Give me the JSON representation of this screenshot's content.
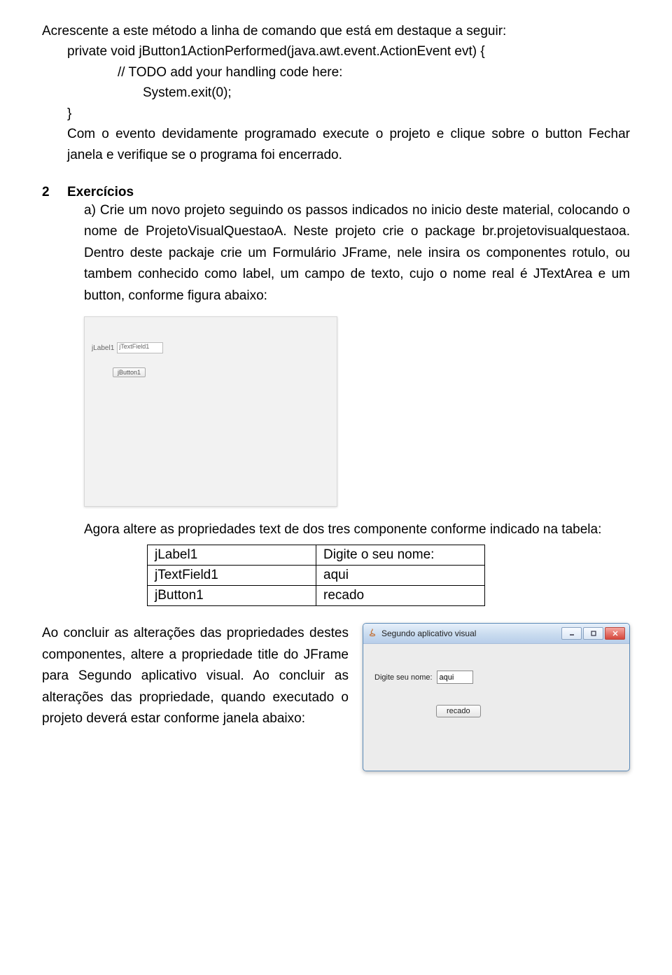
{
  "intro": {
    "line": "Acrescente a este método a linha de comando que está em destaque a seguir:"
  },
  "code": {
    "l1": "private void jButton1ActionPerformed(java.awt.event.ActionEvent evt) {",
    "l2": "// TODO add your handling code here:",
    "l3": "System.exit(0);",
    "l4": "}",
    "after": "Com o evento devidamente programado execute o projeto e clique sobre o button Fechar janela e verifique se o programa foi encerrado."
  },
  "section": {
    "num": "2",
    "title": "Exercícios"
  },
  "exercise": {
    "a": "a) Crie um novo projeto seguindo os passos indicados no inicio deste material, colocando o nome de ProjetoVisualQuestaoA. Neste projeto crie o package br.projetovisualquestaoa. Dentro deste packaje crie um Formulário JFrame, nele insira os componentes rotulo, ou tambem conhecido como label, um campo de texto, cujo o nome real é JTextArea e um button, conforme figura abaixo:"
  },
  "mock1": {
    "label": "jLabel1",
    "textfield": "jTextField1",
    "button": "jButton1"
  },
  "between": "Agora altere as propriedades text de dos tres componente conforme indicado na tabela:",
  "table": {
    "r1c1": "jLabel1",
    "r1c2": "Digite o seu nome:",
    "r2c1": "jTextField1",
    "r2c2": "aqui",
    "r3c1": "jButton1",
    "r3c2": "recado"
  },
  "final_para": "Ao concluir as alterações das propriedades destes componentes, altere a propriedade title do JFrame para Segundo aplicativo visual. Ao concluir as alterações das propriedade, quando executado o projeto deverá estar conforme janela abaixo:",
  "win": {
    "title": "Segundo aplicativo visual",
    "label": "Digite seu nome:",
    "input_value": "aqui",
    "button": "recado"
  }
}
